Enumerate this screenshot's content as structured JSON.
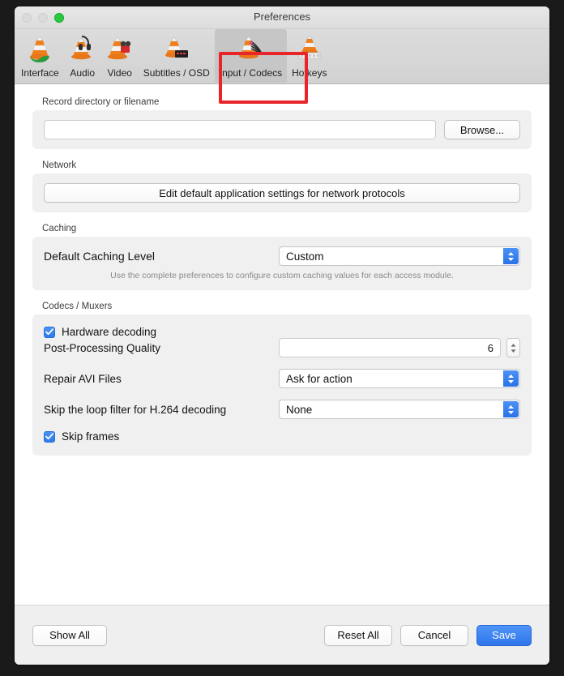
{
  "window": {
    "title": "Preferences",
    "traffic_lights": [
      "close-button",
      "minimize-button",
      "zoom-button"
    ]
  },
  "toolbar": {
    "tabs": [
      {
        "label": "Interface",
        "icon": "vlc-cone-interface-icon",
        "selected": false
      },
      {
        "label": "Audio",
        "icon": "vlc-cone-audio-icon",
        "selected": false
      },
      {
        "label": "Video",
        "icon": "vlc-cone-video-icon",
        "selected": false
      },
      {
        "label": "Subtitles / OSD",
        "icon": "vlc-cone-subtitles-icon",
        "selected": false
      },
      {
        "label": "Input / Codecs",
        "icon": "vlc-cone-input-icon",
        "selected": true
      },
      {
        "label": "Hotkeys",
        "icon": "vlc-cone-hotkeys-icon",
        "selected": false
      }
    ],
    "highlight_color": "#e8262a"
  },
  "content": {
    "record": {
      "title": "Record directory or filename",
      "path_value": "",
      "path_placeholder": "",
      "browse_label": "Browse..."
    },
    "network": {
      "title": "Network",
      "edit_defaults_label": "Edit default application settings for network protocols"
    },
    "caching": {
      "title": "Caching",
      "level_label": "Default Caching Level",
      "level_value": "Custom",
      "hint": "Use the complete preferences to configure custom caching values for each access module."
    },
    "codecs": {
      "title": "Codecs / Muxers",
      "hardware_decoding_label": "Hardware decoding",
      "hardware_decoding_checked": true,
      "post_processing_label": "Post-Processing Quality",
      "post_processing_value": "6",
      "repair_avi_label": "Repair AVI Files",
      "repair_avi_value": "Ask for action",
      "loop_filter_label": "Skip the loop filter for H.264 decoding",
      "loop_filter_value": "None",
      "skip_frames_label": "Skip frames",
      "skip_frames_checked": true
    }
  },
  "footer": {
    "show_all_label": "Show All",
    "reset_all_label": "Reset All",
    "cancel_label": "Cancel",
    "save_label": "Save",
    "accent_color": "#2f75ec"
  }
}
